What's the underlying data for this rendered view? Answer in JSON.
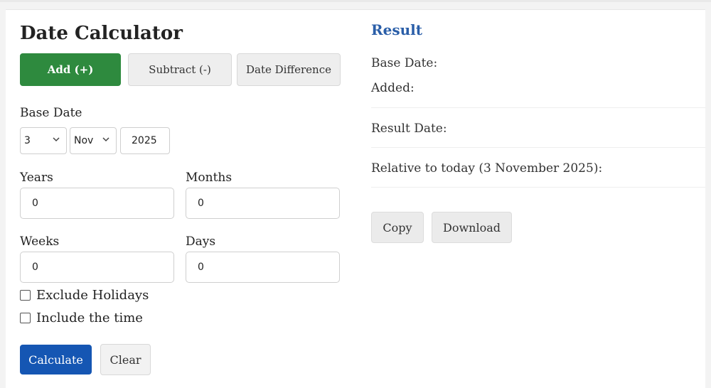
{
  "calculator": {
    "title": "Date Calculator",
    "modes": [
      "Add (+)",
      "Subtract (-)",
      "Date Difference"
    ],
    "active_mode": "Add (+)",
    "base_date_label": "Base Date",
    "base_date": {
      "day": "3",
      "month": "Nov",
      "year": "2025"
    },
    "fields": {
      "years": {
        "label": "Years",
        "value": "0"
      },
      "months": {
        "label": "Months",
        "value": "0"
      },
      "weeks": {
        "label": "Weeks",
        "value": "0"
      },
      "days": {
        "label": "Days",
        "value": "0"
      }
    },
    "options": {
      "exclude_holidays": {
        "label": "Exclude Holidays",
        "checked": false
      },
      "include_time": {
        "label": "Include the time",
        "checked": false
      }
    },
    "calculate_label": "Calculate",
    "clear_label": "Clear"
  },
  "result": {
    "title": "Result",
    "base_date_label": "Base Date:",
    "added_label": "Added:",
    "result_date_label": "Result Date:",
    "relative_label": "Relative to today (3 November 2025):",
    "copy_label": "Copy",
    "download_label": "Download"
  },
  "colors": {
    "active_mode": "#2e8a3e",
    "primary": "#1556b3",
    "result_title": "#2a5ea8"
  }
}
